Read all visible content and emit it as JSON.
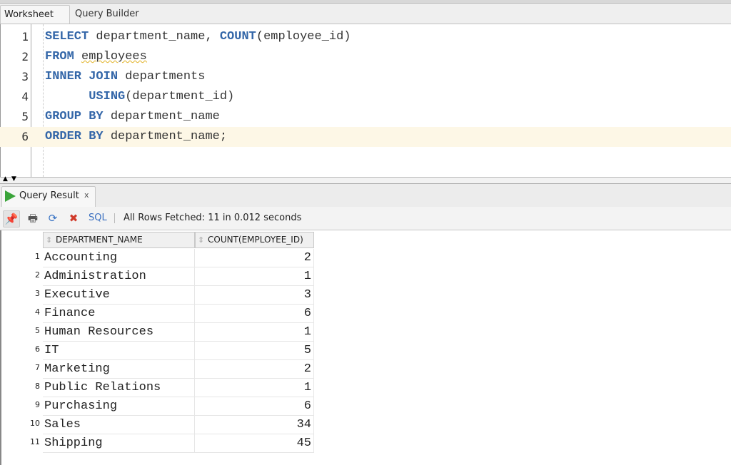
{
  "editor_tabs": [
    {
      "label": "Worksheet",
      "active": true
    },
    {
      "label": "Query Builder",
      "active": false
    }
  ],
  "editor": {
    "current_line": 6,
    "lines": [
      {
        "number": "1",
        "tokens": [
          {
            "t": "SELECT",
            "kw": true
          },
          {
            "t": " department_name, ",
            "kw": false
          },
          {
            "t": "COUNT",
            "kw": true
          },
          {
            "t": "(employee_id)",
            "kw": false
          }
        ]
      },
      {
        "number": "2",
        "tokens": [
          {
            "t": "FROM",
            "kw": true
          },
          {
            "t": " ",
            "kw": false
          },
          {
            "t": "employees",
            "kw": false,
            "squiggle": true
          }
        ]
      },
      {
        "number": "3",
        "tokens": [
          {
            "t": "INNER JOIN",
            "kw": true
          },
          {
            "t": " departments",
            "kw": false
          }
        ]
      },
      {
        "number": "4",
        "tokens": [
          {
            "t": "      ",
            "kw": false
          },
          {
            "t": "USING",
            "kw": true
          },
          {
            "t": "(department_id)",
            "kw": false
          }
        ]
      },
      {
        "number": "5",
        "tokens": [
          {
            "t": "GROUP BY",
            "kw": true
          },
          {
            "t": " department_name",
            "kw": false
          }
        ]
      },
      {
        "number": "6",
        "tokens": [
          {
            "t": "ORDER BY",
            "kw": true
          },
          {
            "t": " department_name;",
            "kw": false
          }
        ]
      }
    ]
  },
  "result_tab": {
    "label": "Query Result",
    "close": "x"
  },
  "toolbar": {
    "sql_label": "SQL",
    "status": "All Rows Fetched: 11 in 0.012 seconds"
  },
  "grid": {
    "columns": [
      "DEPARTMENT_NAME",
      "COUNT(EMPLOYEE_ID)"
    ],
    "rows": [
      {
        "n": "1",
        "name": "Accounting",
        "count": "2"
      },
      {
        "n": "2",
        "name": "Administration",
        "count": "1"
      },
      {
        "n": "3",
        "name": "Executive",
        "count": "3"
      },
      {
        "n": "4",
        "name": "Finance",
        "count": "6"
      },
      {
        "n": "5",
        "name": "Human Resources",
        "count": "1"
      },
      {
        "n": "6",
        "name": "IT",
        "count": "5"
      },
      {
        "n": "7",
        "name": "Marketing",
        "count": "2"
      },
      {
        "n": "8",
        "name": "Public Relations",
        "count": "1"
      },
      {
        "n": "9",
        "name": "Purchasing",
        "count": "6"
      },
      {
        "n": "10",
        "name": "Sales",
        "count": "34"
      },
      {
        "n": "11",
        "name": "Shipping",
        "count": "45"
      }
    ]
  }
}
